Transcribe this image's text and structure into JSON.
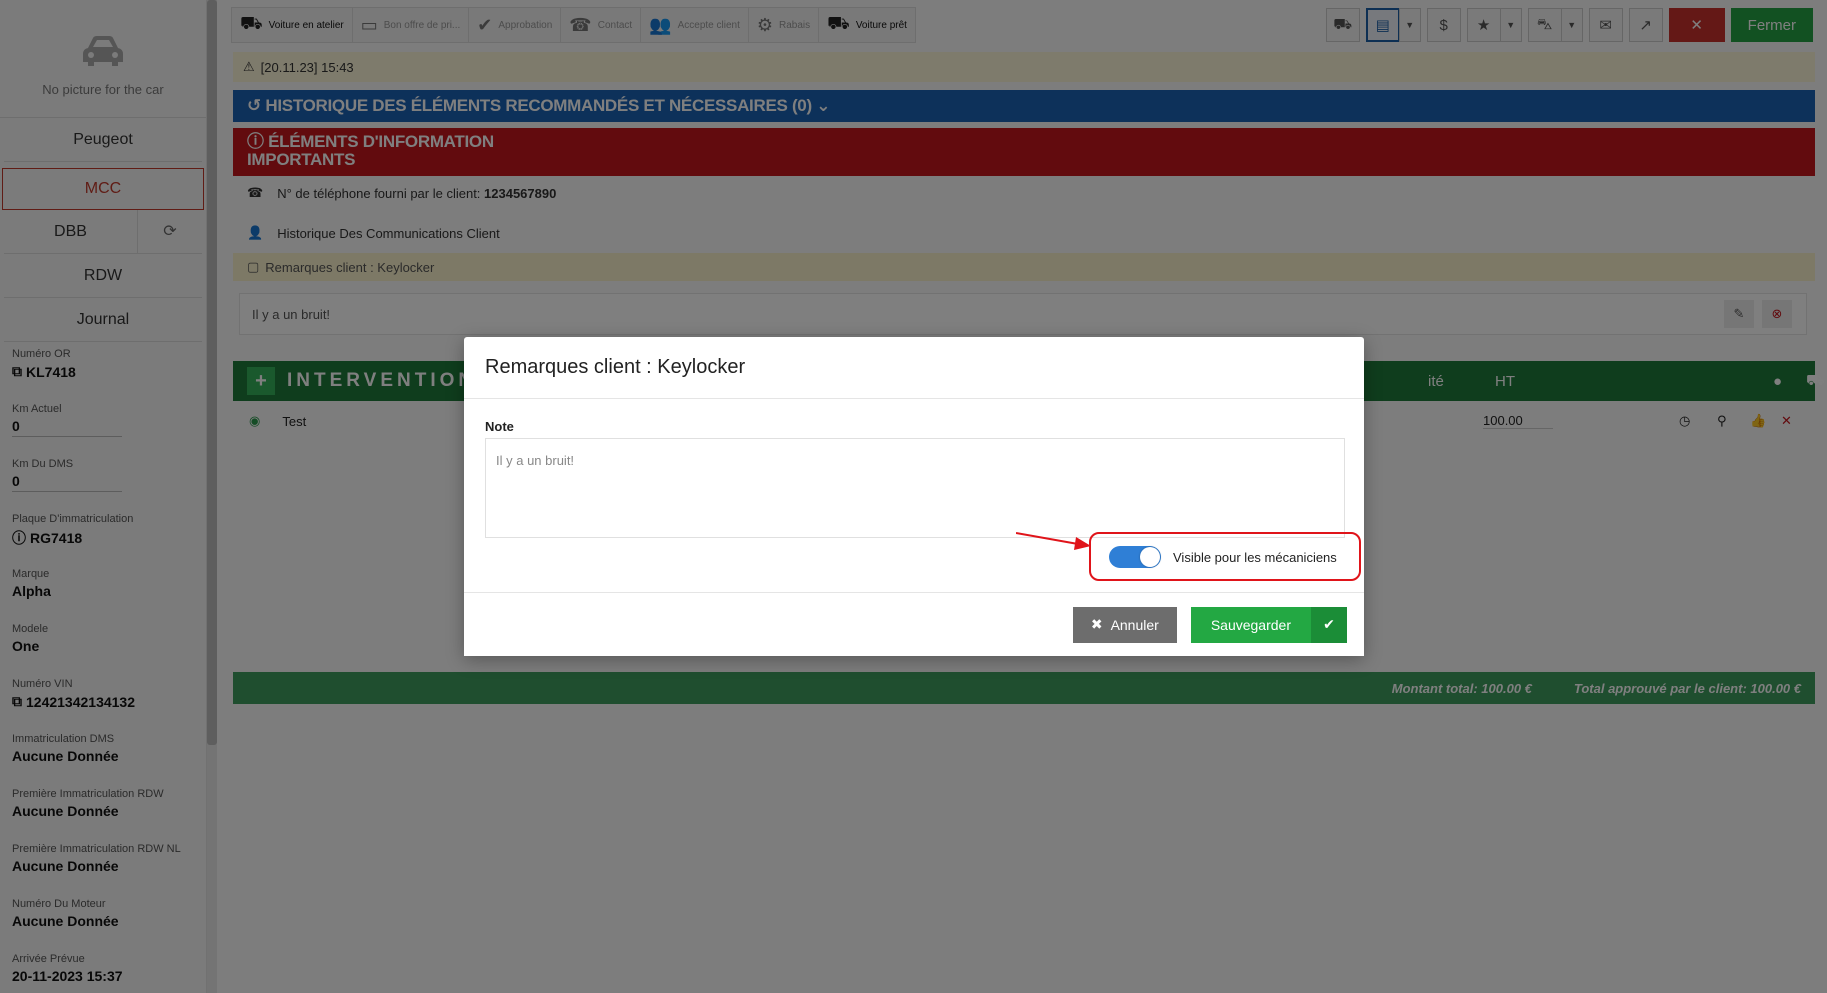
{
  "sidebar": {
    "no_picture": "No picture for the car",
    "brand": "Peugeot",
    "mcc": "MCC",
    "dbb": "DBB",
    "rdw": "RDW",
    "journal": "Journal",
    "fields": [
      {
        "label": "Numéro OR",
        "value": "KL7418"
      },
      {
        "label": "Km Actuel",
        "value": "0"
      },
      {
        "label": "Km Du DMS",
        "value": "0"
      },
      {
        "label": "Plaque D'immatriculation",
        "value": "RG7418"
      },
      {
        "label": "Marque",
        "value": "Alpha"
      },
      {
        "label": "Modele",
        "value": "One"
      },
      {
        "label": "Numéro VIN",
        "value": "12421342134132"
      },
      {
        "label": "Immatriculation DMS",
        "value": "Aucune Donnée"
      },
      {
        "label": "Première Immatriculation RDW",
        "value": "Aucune Donnée"
      },
      {
        "label": "Première Immatriculation RDW NL",
        "value": "Aucune Donnée"
      },
      {
        "label": "Numéro Du Moteur",
        "value": "Aucune Donnée"
      },
      {
        "label": "Arrivée Prévue",
        "value": "20-11-2023 15:37"
      }
    ]
  },
  "toolbar": {
    "steps": [
      "Voiture en atelier",
      "Bon offre de pri...",
      "Approbation",
      "Contact",
      "Accepte client",
      "Rabais",
      "Voiture prêt"
    ],
    "close_label": "Fermer"
  },
  "warning": {
    "text": "[20.11.23] 15:43"
  },
  "history": {
    "title": "HISTORIQUE DES ÉLÉMENTS RECOMMANDÉS ET NÉCESSAIRES (0)"
  },
  "info": {
    "title_line1": "ÉLÉMENTS D'INFORMATION",
    "title_line2": "IMPORTANTS",
    "phone_prefix": "N° de téléphone fourni par le client: ",
    "phone": "1234567890",
    "comm_history": "Historique Des Communications Client"
  },
  "remarks": {
    "title": "Remarques client : Keylocker",
    "note": "Il y a un bruit!"
  },
  "interventions": {
    "title": "INTERVENTION",
    "col_qty_partial": "ité",
    "col_ht": "HT",
    "rows": [
      {
        "name": "Test",
        "ht": "100.00"
      }
    ]
  },
  "totals": {
    "total": "Montant total: 100.00 €",
    "approved": "Total approuvé par le client: 100.00 €"
  },
  "modal": {
    "title": "Remarques client : Keylocker",
    "note_label": "Note",
    "note_value": "Il y a un bruit!",
    "visible_label": "Visible pour les mécaniciens",
    "visible_on": true,
    "cancel_label": "Annuler",
    "save_label": "Sauvegarder"
  },
  "colors": {
    "primary": "#2f7fd6",
    "success": "#23a843",
    "danger": "#c5161d",
    "highlight": "#e0141a"
  }
}
